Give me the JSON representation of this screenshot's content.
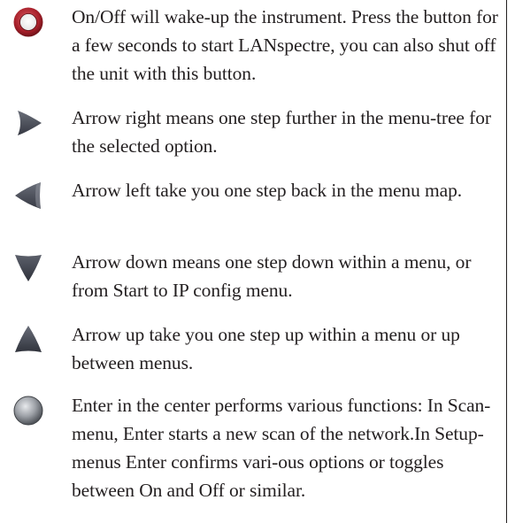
{
  "entries": [
    {
      "icon": "power-ring-icon",
      "text": "On/Off will wake-up the instrument. Press the button for a few seconds to start LANspectre, you can also shut off the unit with this button."
    },
    {
      "icon": "arrow-right-icon",
      "text": "Arrow right means one step further in the menu-tree for the selected option."
    },
    {
      "icon": "arrow-left-icon",
      "text": "Arrow left take you one step back in the menu map."
    },
    {
      "icon": "arrow-down-icon",
      "text": "Arrow down means one step down within a menu, or from Start to IP config menu."
    },
    {
      "icon": "arrow-up-icon",
      "text": "Arrow up take you one step up within a menu or up between menus."
    },
    {
      "icon": "enter-button-icon",
      "text": "Enter in the center performs various functions: In Scan-menu, Enter starts a new scan of the network.In Setup-menus Enter confirms vari-ous options or toggles between On and Off or similar."
    }
  ],
  "colors": {
    "power_ring": "#a8202a",
    "arrow": "#4a4d57",
    "enter": "#8c9096",
    "text": "#231f20"
  }
}
